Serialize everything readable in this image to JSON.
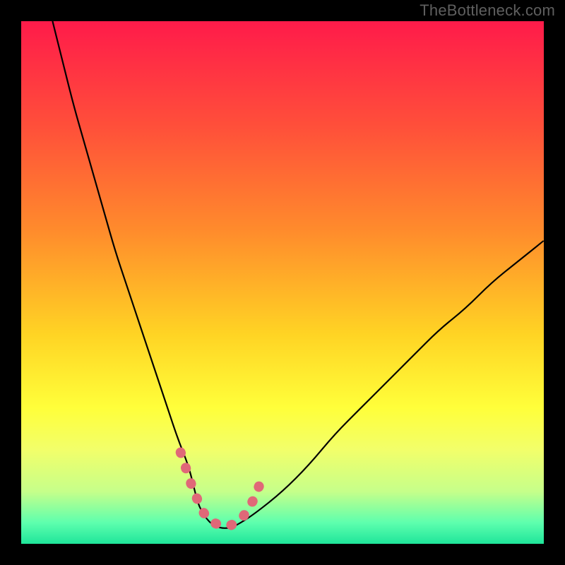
{
  "source_label": "TheBottleneck.com",
  "chart_data": {
    "type": "line",
    "title": "",
    "xlabel": "",
    "ylabel": "",
    "xlim": [
      0,
      100
    ],
    "ylim": [
      0,
      100
    ],
    "series": [
      {
        "name": "curve",
        "x": [
          6,
          8,
          10,
          12,
          14,
          16,
          18,
          20,
          22,
          24,
          26,
          28,
          30,
          32,
          33,
          34,
          36,
          38,
          40,
          42,
          45,
          50,
          55,
          60,
          65,
          70,
          75,
          80,
          85,
          90,
          95,
          100
        ],
        "y": [
          100,
          92,
          84,
          77,
          70,
          63,
          56,
          50,
          44,
          38,
          32,
          26,
          20,
          15,
          11,
          7,
          4,
          3,
          3,
          4,
          6,
          10,
          15,
          21,
          26,
          31,
          36,
          41,
          45,
          50,
          54,
          58
        ]
      }
    ],
    "pink_segment": {
      "name": "highlight",
      "x": [
        30.5,
        31.5,
        32.5,
        33.5,
        34.5,
        36,
        38,
        40,
        42,
        43,
        44.5,
        45.5
      ],
      "y": [
        17.5,
        14.5,
        11.5,
        9,
        6.5,
        4.5,
        3.5,
        3.5,
        4.5,
        6,
        8.5,
        11
      ]
    },
    "background_gradient": {
      "stops": [
        {
          "offset": 0.0,
          "color": "#ff1b4a"
        },
        {
          "offset": 0.2,
          "color": "#ff4f3a"
        },
        {
          "offset": 0.4,
          "color": "#ff8b2c"
        },
        {
          "offset": 0.6,
          "color": "#ffd424"
        },
        {
          "offset": 0.74,
          "color": "#ffff3a"
        },
        {
          "offset": 0.82,
          "color": "#f2ff6a"
        },
        {
          "offset": 0.9,
          "color": "#c6ff8a"
        },
        {
          "offset": 0.96,
          "color": "#5dffae"
        },
        {
          "offset": 1.0,
          "color": "#1fe59a"
        }
      ]
    }
  }
}
